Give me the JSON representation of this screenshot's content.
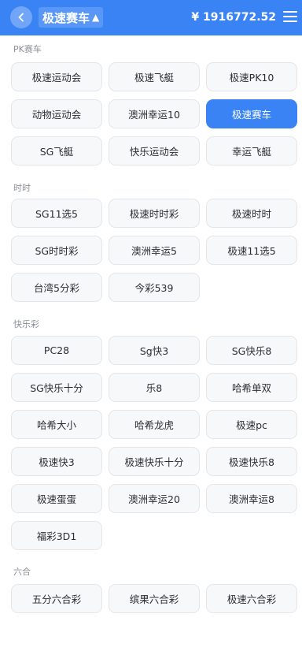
{
  "header": {
    "title": "极速赛车",
    "title_caret": "▲",
    "balance": "¥ 1916772.52",
    "back_icon": "chevron-left-icon",
    "menu_icon": "hamburger-menu-icon"
  },
  "colors": {
    "accent": "#3a83f5",
    "button_bg": "#f7f8fa",
    "label": "#8b8f96"
  },
  "sections": [
    {
      "label": "PK赛车",
      "items": [
        "极速运动会",
        "极速飞艇",
        "极速PK10",
        "动物运动会",
        "澳洲幸运10",
        "极速赛车",
        "SG飞艇",
        "快乐运动会",
        "幸运飞艇"
      ],
      "active": 5
    },
    {
      "label": "时时",
      "items": [
        "SG11选5",
        "极速时时彩",
        "极速时时",
        "SG时时彩",
        "澳洲幸运5",
        "极速11选5",
        "台湾5分彩",
        "今彩539"
      ],
      "active": -1
    },
    {
      "label": "快乐彩",
      "items": [
        "PC28",
        "Sg快3",
        "SG快乐8",
        "SG快乐十分",
        "乐8",
        "哈希单双",
        "哈希大小",
        "哈希龙虎",
        "极速pc",
        "极速快3",
        "极速快乐十分",
        "极速快乐8",
        "极速蛋蛋",
        "澳洲幸运20",
        "澳洲幸运8",
        "福彩3D1"
      ],
      "active": -1
    },
    {
      "label": "六合",
      "items": [
        "五分六合彩",
        "缤果六合彩",
        "极速六合彩"
      ],
      "active": -1
    }
  ]
}
